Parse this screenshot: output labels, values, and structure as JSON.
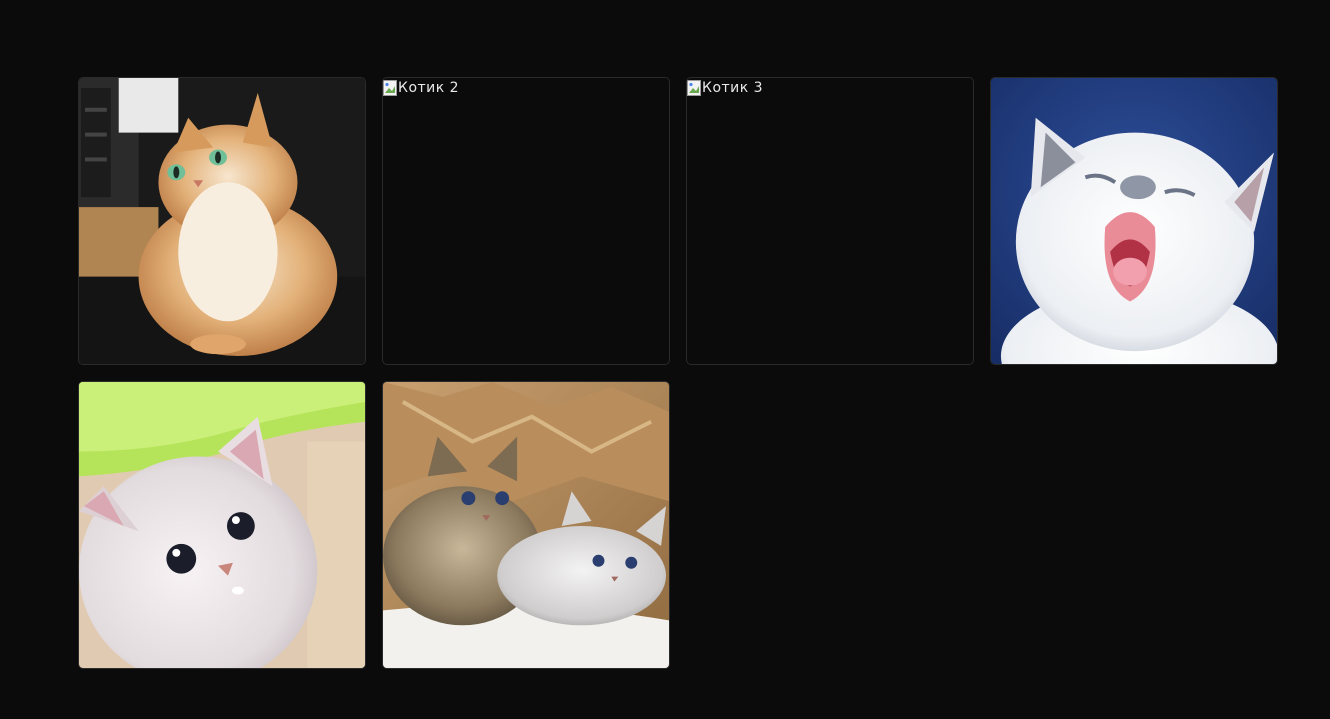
{
  "gallery": {
    "items": [
      {
        "alt": "",
        "broken": false,
        "subject": "fluffy-ginger-cat"
      },
      {
        "alt": "Котик 2",
        "broken": true
      },
      {
        "alt": "Котик 3",
        "broken": true
      },
      {
        "alt": "",
        "broken": false,
        "subject": "white-kitten-yawning"
      },
      {
        "alt": "",
        "broken": false,
        "subject": "white-kitten-closeup"
      },
      {
        "alt": "",
        "broken": false,
        "subject": "kittens-in-paper-bag"
      }
    ]
  },
  "colors": {
    "background": "#0b0b0b",
    "tile_border": "#2a2a2a",
    "alt_text": "#e8e8e8"
  }
}
